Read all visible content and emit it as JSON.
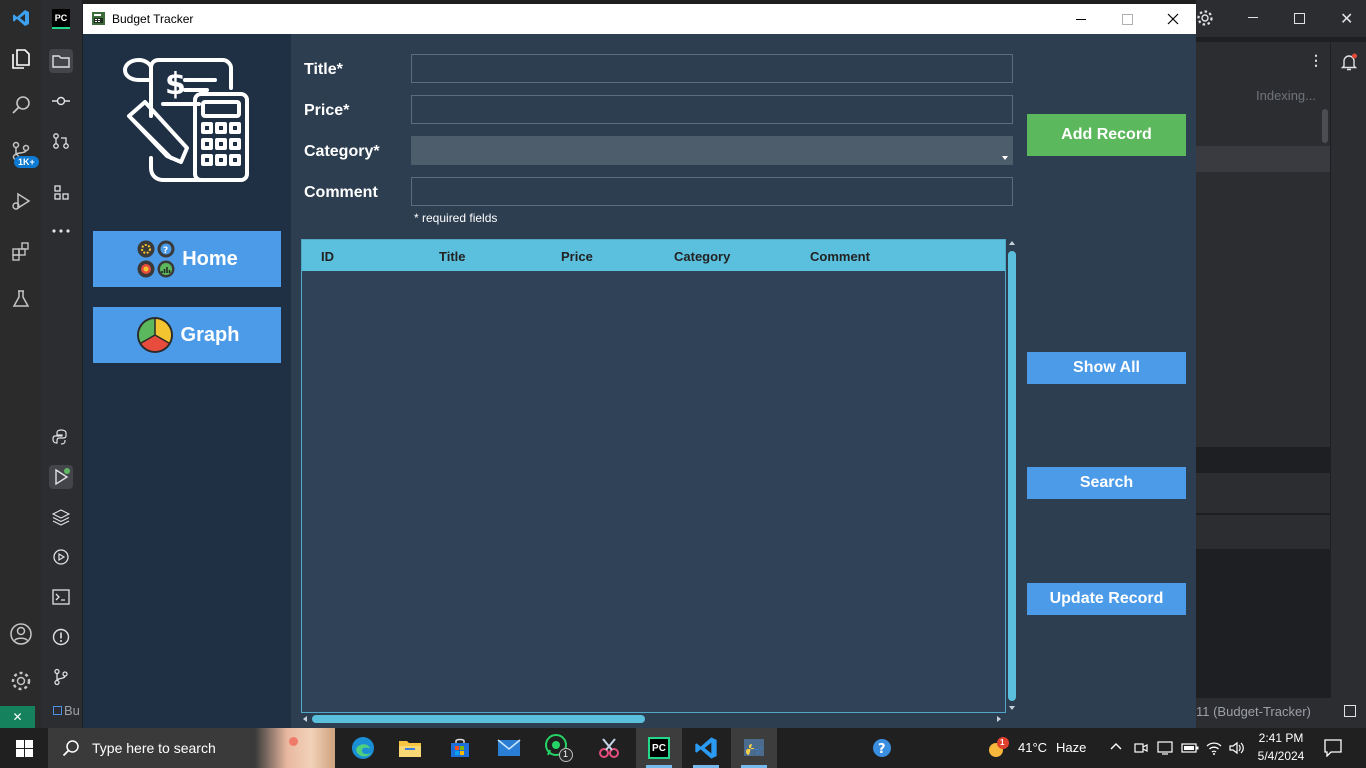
{
  "window": {
    "title": "Budget Tracker"
  },
  "sidebar": {
    "nav": [
      {
        "label": "Home"
      },
      {
        "label": "Graph"
      }
    ]
  },
  "form": {
    "fields": [
      {
        "label": "Title*",
        "value": ""
      },
      {
        "label": "Price*",
        "value": ""
      },
      {
        "label": "Category*",
        "value": ""
      },
      {
        "label": "Comment",
        "value": ""
      }
    ],
    "required_note": "* required fields"
  },
  "actions": {
    "add_record": "Add Record",
    "show_all": "Show All",
    "search": "Search",
    "update_record": "Update Record"
  },
  "table": {
    "columns": [
      "ID",
      "Title",
      "Price",
      "Category",
      "Comment"
    ],
    "rows": []
  },
  "colors": {
    "window_bg": "#2d3e50",
    "sidebar_bg": "#1f3045",
    "nav_button": "#4c9be8",
    "add_button": "#5cb85c",
    "table_header": "#5bc0de"
  },
  "ide": {
    "indexing_text": "Indexing...",
    "status_right": "11 (Budget-Tracker)",
    "status_left_fragment": "Bu",
    "badge": "1K+"
  },
  "taskbar": {
    "search_placeholder": "Type here to search",
    "weather_temp": "41°C",
    "weather_condition": "Haze",
    "time": "2:41 PM",
    "date": "5/4/2024",
    "whatsapp_badge": "1",
    "weather_badge": "1"
  }
}
